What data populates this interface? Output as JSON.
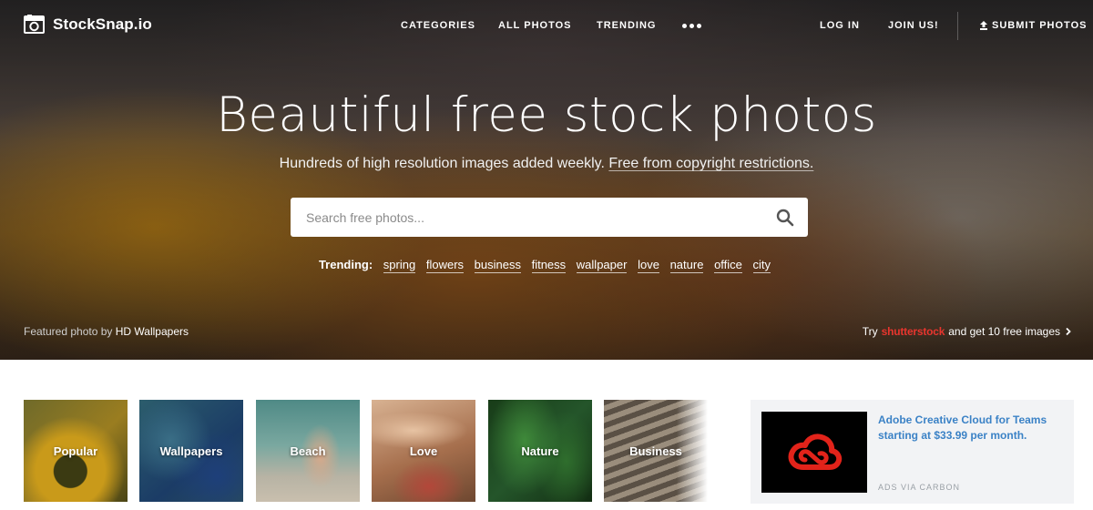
{
  "brand": {
    "name": "StockSnap.io"
  },
  "nav": {
    "categories": "CATEGORIES",
    "all_photos": "ALL PHOTOS",
    "trending": "TRENDING",
    "log_in": "LOG IN",
    "join_us": "JOIN US!",
    "submit_photos": "SUBMIT PHOTOS"
  },
  "hero": {
    "headline": "Beautiful free stock photos",
    "subline": "Hundreds of high resolution images added weekly.",
    "subline_link": "Free from copyright restrictions.",
    "search_placeholder": "Search free photos...",
    "trending_label": "Trending:",
    "trending_tags": [
      "spring",
      "flowers",
      "business",
      "fitness",
      "wallpaper",
      "love",
      "nature",
      "office",
      "city"
    ],
    "featured_prefix": "Featured photo by",
    "featured_author": "HD Wallpapers",
    "promo_prefix": "Try",
    "promo_brand": "shutterstock",
    "promo_suffix": "and get 10 free images"
  },
  "categories": [
    {
      "label": "Popular"
    },
    {
      "label": "Wallpapers"
    },
    {
      "label": "Beach"
    },
    {
      "label": "Love"
    },
    {
      "label": "Nature"
    },
    {
      "label": "Business"
    }
  ],
  "ad": {
    "text": "Adobe Creative Cloud for Teams starting at $33.99 per month.",
    "via": "ADS VIA CARBON"
  },
  "colors": {
    "promo_brand": "#e8352e",
    "ad_link": "#3b82c6",
    "adobe_red": "#e2231a"
  }
}
